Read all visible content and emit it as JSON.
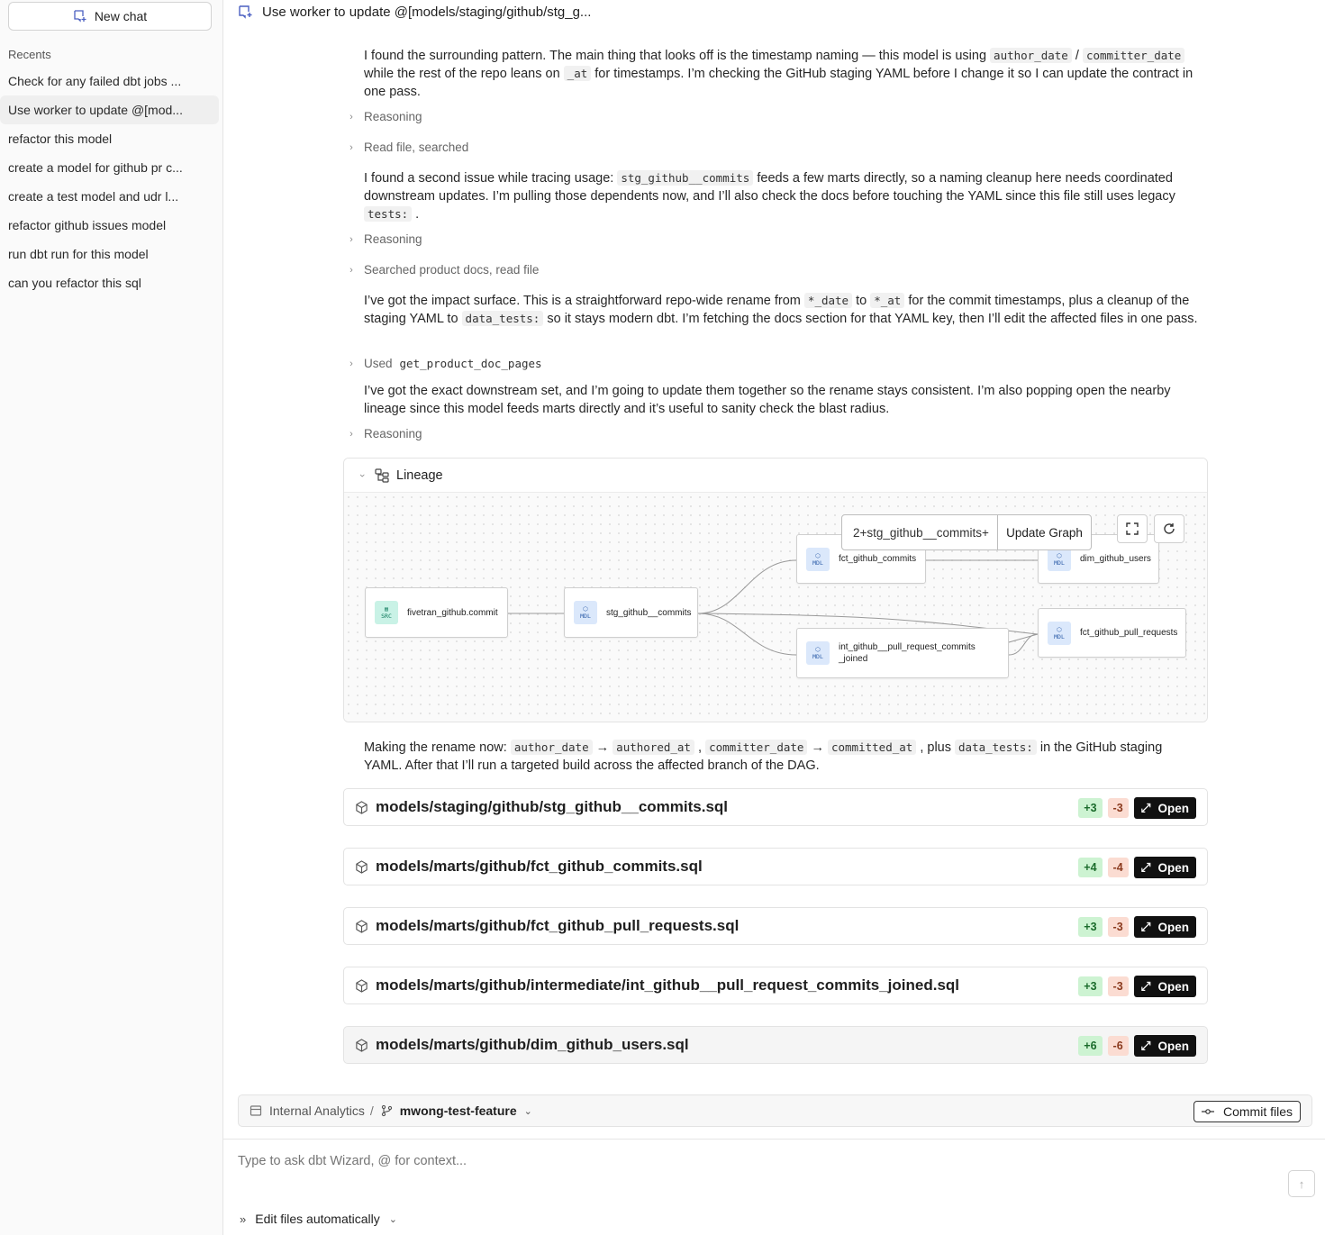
{
  "sidebar": {
    "new_chat_label": "New chat",
    "recents_title": "Recents",
    "items": [
      {
        "label": "Check for any failed dbt jobs ..."
      },
      {
        "label": "Use worker to update @[mod..."
      },
      {
        "label": "refactor this model"
      },
      {
        "label": "create a model for github pr c..."
      },
      {
        "label": "create a test model and udr l..."
      },
      {
        "label": "refactor github issues model"
      },
      {
        "label": "run dbt run for this model"
      },
      {
        "label": "can you refactor this sql"
      }
    ]
  },
  "header": {
    "title": "Use worker to update @[models/staging/github/stg_g..."
  },
  "chat": {
    "p1": {
      "a": "I found the surrounding pattern. The main thing that looks off is the timestamp naming — this model is using ",
      "c1": "author_date",
      "b": " / ",
      "c2": "committer_date",
      "c": " while the rest of the repo leans on ",
      "c3": "_at",
      "d": " for timestamps. I’m checking the GitHub staging YAML before I change it so I can update the contract in one pass."
    },
    "step1": "Reasoning",
    "step2": "Read file, searched",
    "p2": {
      "a": "I found a second issue while tracing usage: ",
      "c1": "stg_github__commits",
      "b": " feeds a few marts directly, so a naming cleanup here needs coordinated downstream updates. I’m pulling those dependents now, and I’ll also check the docs before touching the YAML since this file still uses legacy ",
      "c2": "tests:",
      "c": " ."
    },
    "step3": "Reasoning",
    "step4": "Searched product docs, read file",
    "p3": {
      "a": "I’ve got the impact surface. This is a straightforward repo-wide rename from ",
      "c1": "*_date",
      "b": " to ",
      "c2": "*_at",
      "c": " for the commit timestamps, plus a cleanup of the staging YAML to ",
      "c3": "data_tests:",
      "d": " so it stays modern dbt. I’m fetching the docs section for that YAML key, then I’ll edit the affected files in one pass."
    },
    "step5": {
      "label": "Used",
      "tool": "get_product_doc_pages"
    },
    "p4": "I’ve got the exact downstream set, and I’m going to update them together so the rename stays consistent. I’m also popping open the nearby lineage since this model feeds marts directly and it’s useful to sanity check the blast radius.",
    "step6": "Reasoning",
    "p5": {
      "a": "Making the rename now: ",
      "c1": "author_date",
      "arrow1": " → ",
      "c2": "authored_at",
      "b": " , ",
      "c3": "committer_date",
      "arrow2": " → ",
      "c4": "committed_at",
      "c": " , plus ",
      "c5": "data_tests:",
      "d": " in the GitHub staging YAML. After that I’ll run a targeted build across the affected branch of the DAG."
    }
  },
  "lineage": {
    "title": "Lineage",
    "selector_value": "2+stg_github__commits+",
    "update_label": "Update Graph",
    "nodes": [
      {
        "name": "fivetran_github.commit",
        "type_top": "▤",
        "type": "SRC"
      },
      {
        "name": "stg_github__commits",
        "type_top": "⬡",
        "type": "MDL"
      },
      {
        "name": "fct_github_commits",
        "type_top": "⬡",
        "type": "MDL"
      },
      {
        "name": "int_github__pull_request_commits",
        "name2": "_joined",
        "type_top": "⬡",
        "type": "MDL"
      },
      {
        "name": "dim_github_users",
        "type_top": "⬡",
        "type": "MDL"
      },
      {
        "name": "fct_github_pull_requests",
        "type_top": "⬡",
        "type": "MDL"
      }
    ]
  },
  "files": [
    {
      "path": "models/staging/github/stg_github__commits.sql",
      "added": "+3",
      "removed": "-3",
      "action": "Open"
    },
    {
      "path": "models/marts/github/fct_github_commits.sql",
      "added": "+4",
      "removed": "-4",
      "action": "Open"
    },
    {
      "path": "models/marts/github/fct_github_pull_requests.sql",
      "added": "+3",
      "removed": "-3",
      "action": "Open"
    },
    {
      "path": "models/marts/github/intermediate/int_github__pull_request_commits_joined.sql",
      "added": "+3",
      "removed": "-3",
      "action": "Open"
    },
    {
      "path": "models/marts/github/dim_github_users.sql",
      "added": "+6",
      "removed": "-6",
      "action": "Open"
    }
  ],
  "footer": {
    "project": "Internal Analytics",
    "separator": "/",
    "branch": "mwong-test-feature",
    "commit_label": "Commit files",
    "prompt_placeholder": "Type to ask dbt Wizard, @ for context...",
    "mode_label": "Edit files automatically"
  }
}
